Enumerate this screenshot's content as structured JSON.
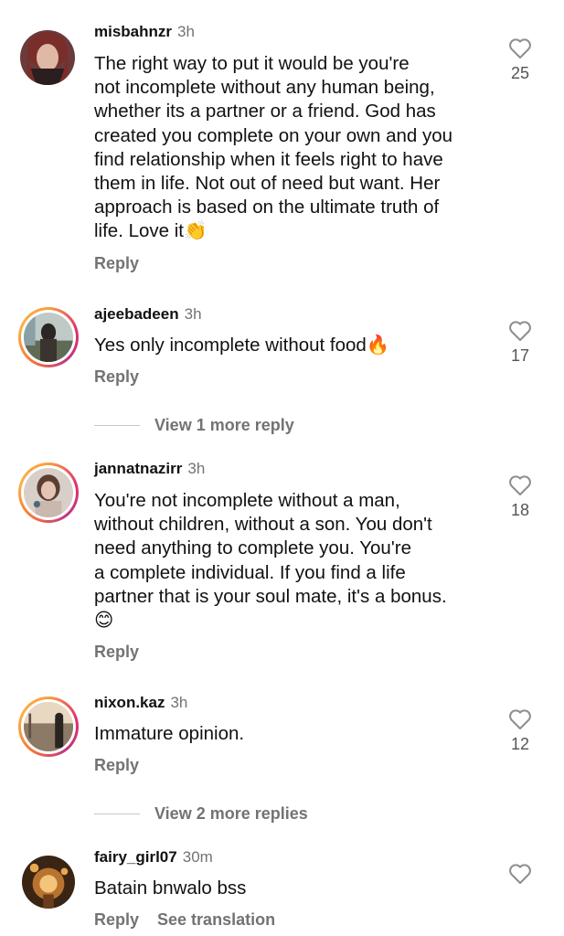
{
  "comments": [
    {
      "username": "misbahnzr",
      "time": "3h",
      "text": "The right way to put it would be you're\nnot incomplete without any human being,\nwhether its a partner or a friend. God has\ncreated you complete on your own and you\nfind relationship when it feels right to have\nthem in life. Not out of need but want. Her\napproach is based on the ultimate truth of\nlife. Love it👏",
      "likes": "25",
      "reply_label": "Reply"
    },
    {
      "username": "ajeebadeen",
      "time": "3h",
      "text": "Yes only incomplete without food🔥",
      "likes": "17",
      "reply_label": "Reply"
    },
    {
      "username": "jannatnazirr",
      "time": "3h",
      "text": "You're not incomplete without a man,\nwithout children, without a son. You don't\nneed anything to complete you. You're\na complete individual. If you find a life\npartner that is your soul mate, it's a bonus.\n😊",
      "likes": "18",
      "reply_label": "Reply"
    },
    {
      "username": "nixon.kaz",
      "time": "3h",
      "text": "Immature opinion.",
      "likes": "12",
      "reply_label": "Reply"
    },
    {
      "username": "fairy_girl07",
      "time": "30m",
      "text": "Batain bnwalo bss",
      "likes": "",
      "reply_label": "Reply",
      "translate_label": "See translation"
    }
  ],
  "view_more": [
    {
      "label": "View 1 more reply"
    },
    {
      "label": "View 2 more replies"
    }
  ],
  "icons": {
    "like": "heart-outline-icon"
  },
  "colors": {
    "muted": "#737373",
    "ring_start": "#f9a03f",
    "ring_end": "#c13584"
  }
}
